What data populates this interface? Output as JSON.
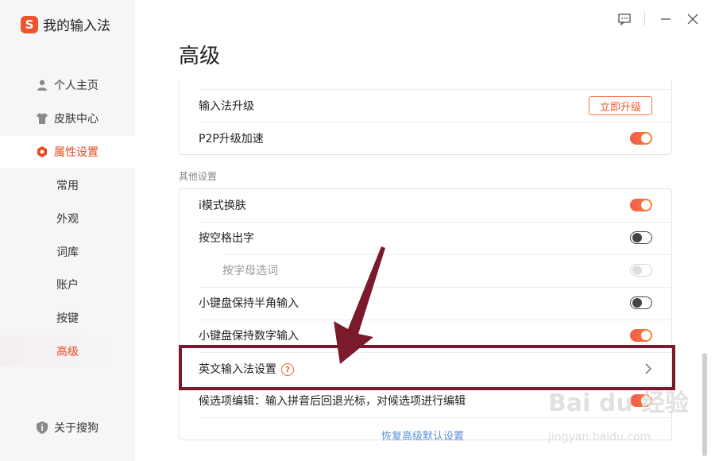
{
  "app": {
    "logo_letter": "S",
    "name": "我的输入法"
  },
  "sidebar": {
    "items": [
      {
        "label": "个人主页",
        "icon": "person-icon"
      },
      {
        "label": "皮肤中心",
        "icon": "shirt-icon"
      },
      {
        "label": "属性设置",
        "icon": "hexagon-settings-icon"
      }
    ],
    "sub_items": [
      "常用",
      "外观",
      "词库",
      "账户",
      "按键",
      "高级"
    ],
    "about": {
      "label": "关于搜狗",
      "icon": "shield-info-icon"
    }
  },
  "page": {
    "title": "高级"
  },
  "upgrade_card": {
    "rows": [
      {
        "label": "输入法升级",
        "button": "立即升级"
      },
      {
        "label": "P2P升级加速",
        "toggle": "on"
      }
    ]
  },
  "other_settings": {
    "section_label": "其他设置",
    "rows": [
      {
        "label": "i模式换肤",
        "toggle": "on"
      },
      {
        "label": "按空格出字",
        "toggle": "off"
      },
      {
        "label": "按字母选词",
        "toggle": "disabled"
      },
      {
        "label": "小键盘保持半角输入",
        "toggle": "off"
      },
      {
        "label": "小键盘保持数字输入",
        "toggle": "on"
      },
      {
        "label": "英文输入法设置",
        "help": "?"
      },
      {
        "label": "候选项编辑：输入拼音后回退光标，对候选项进行编辑",
        "toggle": "on"
      }
    ]
  },
  "footer": {
    "restore_label": "恢复高级默认设置"
  },
  "watermark": {
    "main": "Bai du 经验",
    "sub": "jingyan.baidu.com"
  },
  "colors": {
    "accent": "#e8481f",
    "toggle_on": "#f05a4f",
    "annotation": "#7a1a2a",
    "link": "#5b8fd6"
  }
}
